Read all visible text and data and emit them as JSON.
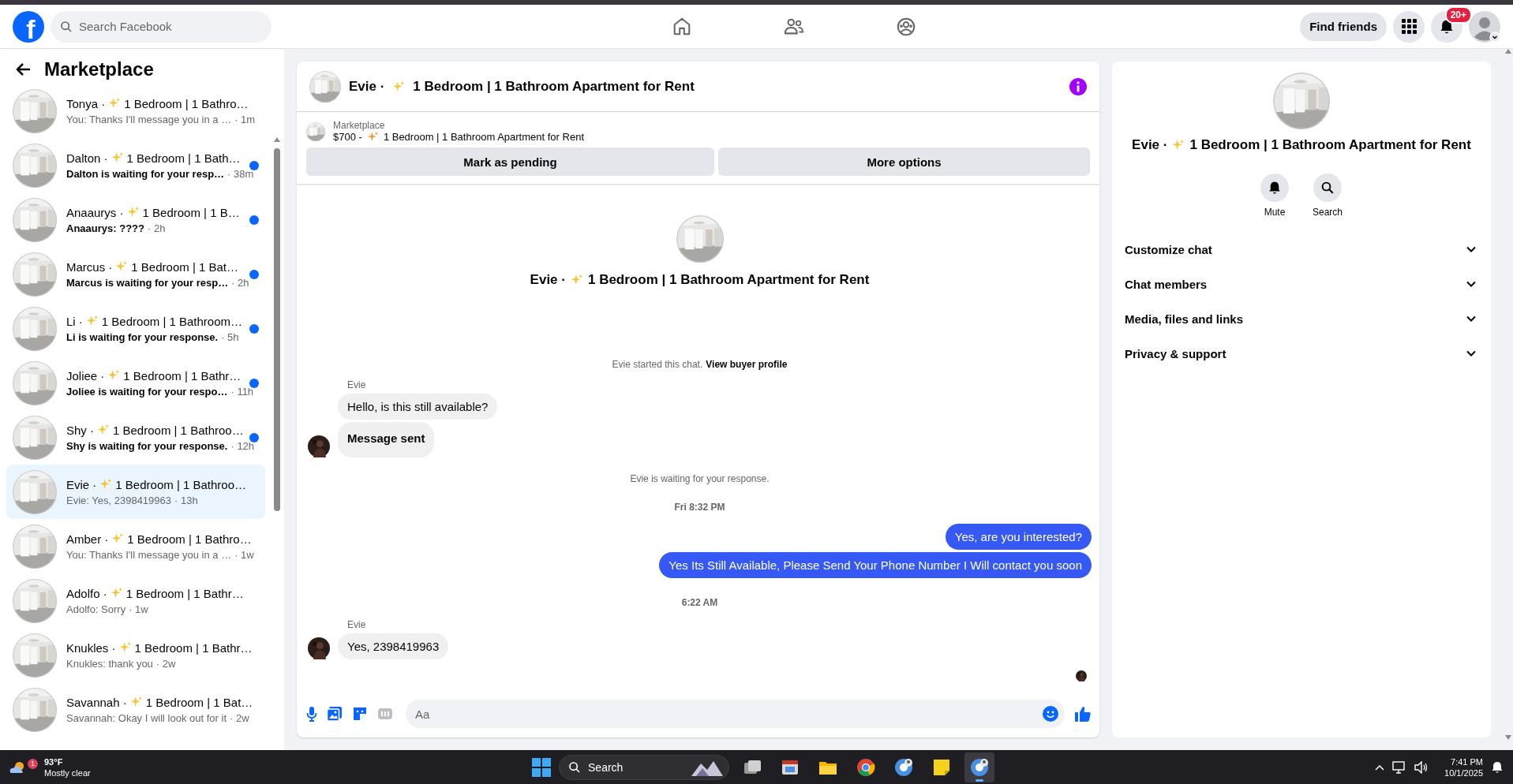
{
  "topbar": {
    "logo_letter": "f",
    "search": {
      "placeholder": "Search Facebook"
    },
    "nav": [
      {
        "kind": "home"
      },
      {
        "kind": "friends"
      },
      {
        "kind": "groups"
      }
    ],
    "find_friends": "Find friends",
    "notifications_badge": "20+"
  },
  "sidebar": {
    "title": "Marketplace",
    "conversations": [
      {
        "name": "Tonya ·",
        "listing": "1 Bedroom | 1 Bathro…",
        "preview": "You: Thanks I'll message you in a …",
        "time": "· 1m",
        "unread": false,
        "selected": false
      },
      {
        "name": "Dalton ·",
        "listing": "1 Bedroom | 1 Bath…",
        "preview": "Dalton is waiting for your resp…",
        "time": "· 38m",
        "unread": true,
        "selected": false
      },
      {
        "name": "Anaaurys ·",
        "listing": "1 Bedroom | 1 B…",
        "preview": "Anaaurys: ????",
        "time": "· 2h",
        "unread": true,
        "selected": false
      },
      {
        "name": "Marcus ·",
        "listing": "1 Bedroom | 1 Bat…",
        "preview": "Marcus is waiting for your resp…",
        "time": "· 2h",
        "unread": true,
        "selected": false
      },
      {
        "name": "Li ·",
        "listing": "1 Bedroom | 1 Bathroom…",
        "preview": "Li is waiting for your response.",
        "time": "· 5h",
        "unread": true,
        "selected": false
      },
      {
        "name": "Joliee ·",
        "listing": "1 Bedroom | 1 Bathr…",
        "preview": "Joliee is waiting for your respo…",
        "time": "· 11h",
        "unread": true,
        "selected": false
      },
      {
        "name": "Shy ·",
        "listing": "1 Bedroom | 1 Bathroo…",
        "preview": "Shy is waiting for your response.",
        "time": "· 12h",
        "unread": true,
        "selected": false
      },
      {
        "name": "Evie ·",
        "listing": "1 Bedroom | 1 Bathroo…",
        "preview": "Evie: Yes, 2398419963",
        "time": "· 13h",
        "unread": false,
        "selected": true
      },
      {
        "name": "Amber ·",
        "listing": "1 Bedroom | 1 Bathro…",
        "preview": "You: Thanks I'll message you in a …",
        "time": "· 1w",
        "unread": false,
        "selected": false
      },
      {
        "name": "Adolfo ·",
        "listing": "1 Bedroom | 1 Bathr…",
        "preview": "Adolfo: Sorry",
        "time": "· 1w",
        "unread": false,
        "selected": false
      },
      {
        "name": "Knukles ·",
        "listing": "1 Bedroom | 1 Bathr…",
        "preview": "Knukles: thank you",
        "time": "· 2w",
        "unread": false,
        "selected": false
      },
      {
        "name": "Savannah ·",
        "listing": "1 Bedroom | 1 Bat…",
        "preview": "Savannah: Okay I will look out for it",
        "time": "· 2w",
        "unread": false,
        "selected": false
      }
    ]
  },
  "chat": {
    "header": {
      "name": "Evie ·",
      "listing": "1 Bedroom | 1 Bathroom Apartment for Rent"
    },
    "listing_bar": {
      "source": "Marketplace",
      "price": "$700 -",
      "title": "1 Bedroom | 1 Bathroom Apartment for Rent",
      "buttons": [
        "Mark as pending",
        "More options"
      ]
    },
    "intro": {
      "name": "Evie ·",
      "listing": "1 Bedroom | 1 Bathroom Apartment for Rent"
    },
    "messages": [
      {
        "kind": "system",
        "text": "Evie started this chat.",
        "link": "View buyer profile"
      },
      {
        "kind": "incoming",
        "sender": "Evie",
        "bubbles": [
          {
            "text": "Hello, is this still available?",
            "bold": false
          },
          {
            "text": "Message sent",
            "bold": true
          }
        ]
      },
      {
        "kind": "system",
        "text": "Evie is waiting for your response."
      },
      {
        "kind": "time",
        "text": "Fri 8:32 PM"
      },
      {
        "kind": "outgoing",
        "bubbles": [
          {
            "text": "Yes, are you interested?",
            "bold": false
          },
          {
            "text": "Yes Its Still Available, Please Send Your Phone Number I Will contact you soon",
            "bold": false
          }
        ]
      },
      {
        "kind": "time",
        "text": "6:22 AM"
      },
      {
        "kind": "incoming",
        "sender": "Evie",
        "bubbles": [
          {
            "text": "Yes, 2398419963",
            "bold": false
          }
        ]
      },
      {
        "kind": "receipt"
      }
    ],
    "composer": {
      "placeholder": "Aa"
    }
  },
  "details": {
    "name": "Evie ·",
    "listing": "1 Bedroom | 1 Bathroom Apartment for Rent",
    "actions": [
      {
        "kind": "mute",
        "label": "Mute"
      },
      {
        "kind": "search",
        "label": "Search"
      }
    ],
    "sections": [
      {
        "label": "Customize chat",
        "expanded": false
      },
      {
        "label": "Chat members",
        "expanded": false
      },
      {
        "label": "Media, files and links",
        "expanded": false
      },
      {
        "label": "Privacy & support",
        "expanded": false
      }
    ]
  },
  "taskbar": {
    "weather": {
      "badge": "1",
      "temp": "93°F",
      "condition": "Mostly clear"
    },
    "search": {
      "placeholder": "Search"
    },
    "apps": [
      {
        "kind": "taskview",
        "active": false
      },
      {
        "kind": "window",
        "active": false
      },
      {
        "kind": "folder",
        "active": false
      },
      {
        "kind": "chrome",
        "active": false
      },
      {
        "kind": "profile",
        "active": false
      },
      {
        "kind": "note",
        "active": false
      },
      {
        "kind": "profile",
        "active": true
      }
    ],
    "time": "7:41 PM",
    "date": "10/1/2025"
  }
}
